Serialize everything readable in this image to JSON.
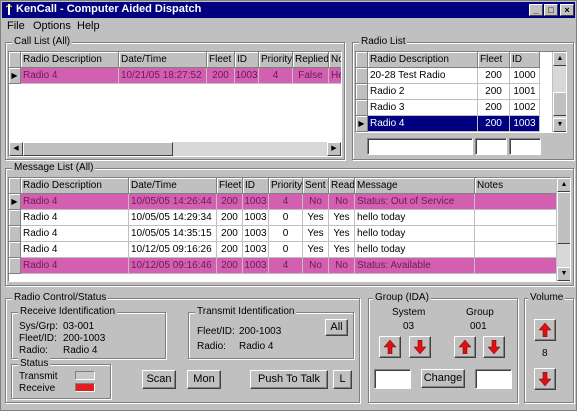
{
  "window": {
    "title": "KenCall - Computer Aided Dispatch"
  },
  "menu": [
    "File",
    "Options",
    "Help"
  ],
  "call_list": {
    "label": "Call List (All)",
    "columns": [
      "Radio Description",
      "Date/Time",
      "Fleet",
      "ID",
      "Priority",
      "Replied",
      "No"
    ],
    "rows": [
      {
        "desc": "Radio 4",
        "datetime": "10/21/05 18:27:52",
        "fleet": "200",
        "id": "1003",
        "priority": "4",
        "replied": "False",
        "note": "He"
      }
    ]
  },
  "radio_list": {
    "label": "Radio List",
    "columns": [
      "Radio Description",
      "Fleet",
      "ID"
    ],
    "rows": [
      {
        "desc": "20-28 Test Radio",
        "fleet": "200",
        "id": "1000"
      },
      {
        "desc": "Radio 2",
        "fleet": "200",
        "id": "1001"
      },
      {
        "desc": "Radio 3",
        "fleet": "200",
        "id": "1002"
      },
      {
        "desc": "Radio 4",
        "fleet": "200",
        "id": "1003"
      }
    ]
  },
  "message_list": {
    "label": "Message List (All)",
    "columns": [
      "Radio Description",
      "Date/Time",
      "Fleet",
      "ID",
      "Priority",
      "Sent",
      "Read",
      "Message",
      "Notes"
    ],
    "rows": [
      {
        "desc": "Radio 4",
        "datetime": "10/05/05 14:26:44",
        "fleet": "200",
        "id": "1003",
        "priority": "4",
        "sent": "No",
        "read": "No",
        "message": "Status: Out of Service",
        "notes": ""
      },
      {
        "desc": "Radio 4",
        "datetime": "10/05/05 14:29:34",
        "fleet": "200",
        "id": "1003",
        "priority": "0",
        "sent": "Yes",
        "read": "Yes",
        "message": "hello today",
        "notes": ""
      },
      {
        "desc": "Radio 4",
        "datetime": "10/05/05 14:35:15",
        "fleet": "200",
        "id": "1003",
        "priority": "0",
        "sent": "Yes",
        "read": "Yes",
        "message": "hello today",
        "notes": ""
      },
      {
        "desc": "Radio 4",
        "datetime": "10/12/05 09:16:26",
        "fleet": "200",
        "id": "1003",
        "priority": "0",
        "sent": "Yes",
        "read": "Yes",
        "message": "hello today",
        "notes": ""
      },
      {
        "desc": "Radio 4",
        "datetime": "10/12/05 09:16:46",
        "fleet": "200",
        "id": "1003",
        "priority": "4",
        "sent": "No",
        "read": "No",
        "message": "Status: Available",
        "notes": ""
      }
    ]
  },
  "radio_control": {
    "label": "Radio Control/Status",
    "receive": {
      "label": "Receive Identification",
      "sys_grp_label": "Sys/Grp:",
      "sys_grp": "03-001",
      "fleet_id_label": "Fleet/ID:",
      "fleet_id": "200-1003",
      "radio_label": "Radio:",
      "radio": "Radio 4"
    },
    "transmit": {
      "label": "Transmit Identification",
      "fleet_id_label": "Fleet/ID:",
      "fleet_id": "200-1003",
      "radio_label": "Radio:",
      "radio": "Radio 4",
      "all_button": "All"
    },
    "status": {
      "label": "Status",
      "transmit_label": "Transmit",
      "receive_label": "Receive",
      "transmit_color": "#c8c8c8",
      "receive_color": "#e02020"
    },
    "buttons": {
      "scan": "Scan",
      "mon": "Mon",
      "ptt": "Push To Talk",
      "l": "L"
    }
  },
  "group_ida": {
    "label": "Group (IDA)",
    "system_label": "System",
    "system_value": "03",
    "group_label": "Group",
    "group_value": "001",
    "change_button": "Change"
  },
  "volume": {
    "label": "Volume",
    "value": "8"
  }
}
